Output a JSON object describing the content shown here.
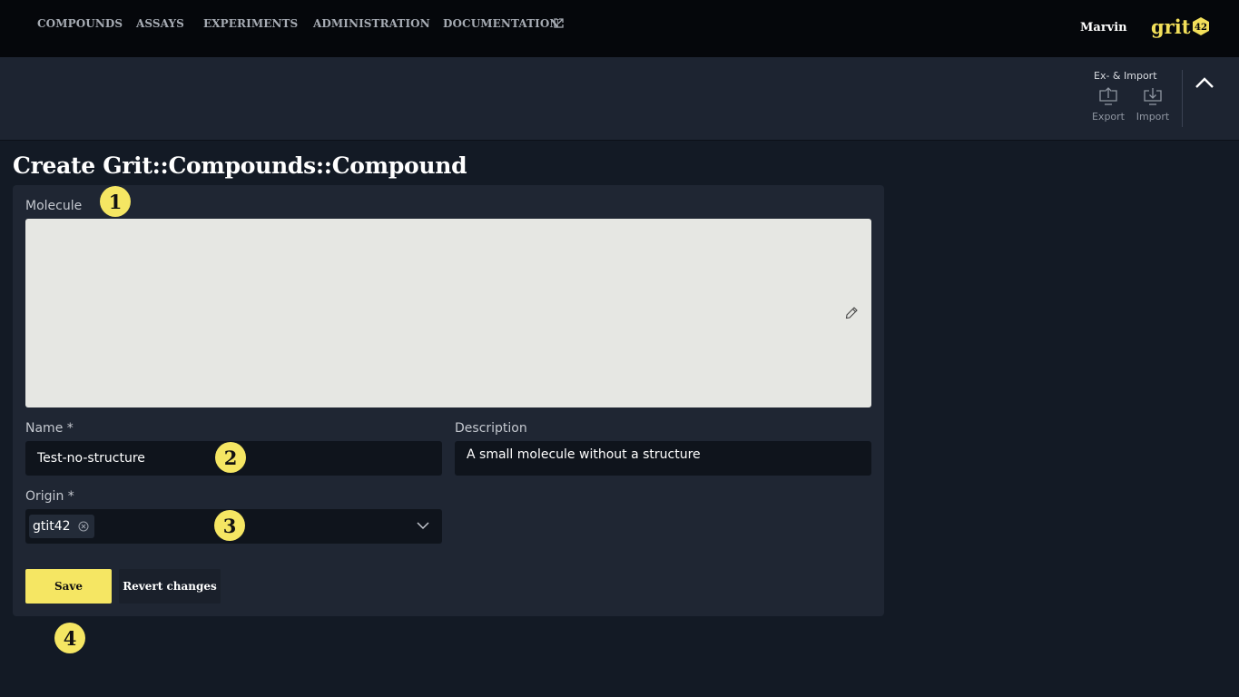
{
  "nav": {
    "items": [
      "COMPOUNDS",
      "ASSAYS",
      "EXPERIMENTS",
      "ADMINISTRATION",
      "DOCUMENTATION"
    ],
    "user": "Marvin",
    "logo_text": "grit",
    "logo_badge": "42"
  },
  "toolbar": {
    "group_label": "Ex- & Import",
    "export_label": "Export",
    "import_label": "Import"
  },
  "page": {
    "title": "Create Grit::Compounds::Compound"
  },
  "form": {
    "molecule_label": "Molecule",
    "name_label": "Name *",
    "name_value": "Test-no-structure",
    "description_label": "Description",
    "description_value": "A small molecule without a structure",
    "origin_label": "Origin *",
    "origin_value": "gtit42",
    "save_label": "Save",
    "revert_label": "Revert changes"
  },
  "markers": [
    "1",
    "2",
    "3",
    "4"
  ],
  "colors": {
    "accent": "#f5e663",
    "background": "#131a25",
    "nav_background": "#05070b",
    "card_background": "#1f2633",
    "molecule_canvas": "#e6e7e3"
  },
  "icons": [
    "external-link-icon",
    "export-icon",
    "import-icon",
    "chevron-up-icon",
    "pencil-icon",
    "remove-chip-icon",
    "chevron-down-icon"
  ]
}
